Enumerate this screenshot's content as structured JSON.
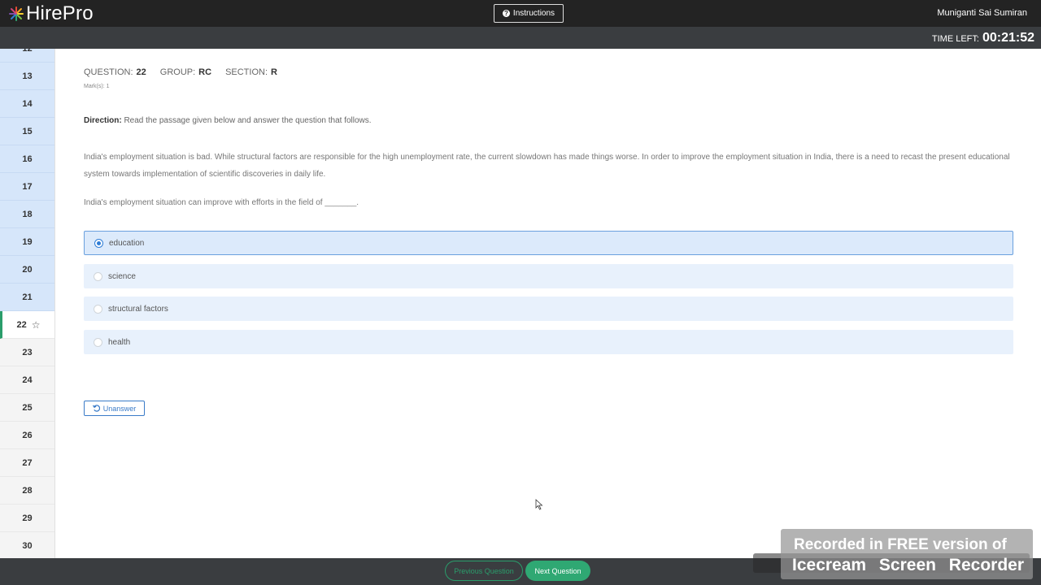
{
  "header": {
    "logo_text": "HirePro",
    "instructions_label": "Instructions",
    "username": "Muniganti Sai Sumiran"
  },
  "timer": {
    "label": "TIME LEFT:",
    "value": "00:21:52"
  },
  "sidebar": {
    "items": [
      {
        "label": "12",
        "state": "answered"
      },
      {
        "label": "13",
        "state": "answered"
      },
      {
        "label": "14",
        "state": "answered"
      },
      {
        "label": "15",
        "state": "answered"
      },
      {
        "label": "16",
        "state": "answered"
      },
      {
        "label": "17",
        "state": "answered"
      },
      {
        "label": "18",
        "state": "answered"
      },
      {
        "label": "19",
        "state": "answered"
      },
      {
        "label": "20",
        "state": "answered"
      },
      {
        "label": "21",
        "state": "answered"
      },
      {
        "label": "22",
        "state": "current"
      },
      {
        "label": "23",
        "state": "unvisited"
      },
      {
        "label": "24",
        "state": "unvisited"
      },
      {
        "label": "25",
        "state": "unvisited"
      },
      {
        "label": "26",
        "state": "unvisited"
      },
      {
        "label": "27",
        "state": "unvisited"
      },
      {
        "label": "28",
        "state": "unvisited"
      },
      {
        "label": "29",
        "state": "unvisited"
      },
      {
        "label": "30",
        "state": "unvisited"
      }
    ]
  },
  "question": {
    "question_label": "QUESTION:",
    "question_number": "22",
    "group_label": "GROUP:",
    "group_value": "RC",
    "section_label": "SECTION:",
    "section_value": "R",
    "marks": "Mark(s):  1",
    "direction_label": "Direction:",
    "direction_text": "Read the passage given below and answer the question that follows.",
    "passage": "India's employment situation is bad. While structural factors are responsible for the high unemployment rate, the current slowdown has made things worse. In order to improve the employment situation in India, there is a need to recast the present educational system towards implementation of scientific discoveries in daily life.",
    "prompt": "India's employment situation can improve with efforts in the field of _______.",
    "options": [
      {
        "label": "education",
        "selected": true
      },
      {
        "label": "science",
        "selected": false
      },
      {
        "label": "structural factors",
        "selected": false
      },
      {
        "label": "health",
        "selected": false
      }
    ],
    "unanswer_label": "Unanswer"
  },
  "footer": {
    "previous_label": "Previous Question",
    "next_label": "Next Question"
  },
  "watermark": {
    "line1": "Recorded in FREE version of",
    "line2": "Icecream Screen Recorder"
  },
  "colors": {
    "topbar": "#232323",
    "subbar": "#3a3d40",
    "accent_green": "#2fa873",
    "accent_blue": "#2f7dd6",
    "answered_bg": "#d6e6fa"
  }
}
